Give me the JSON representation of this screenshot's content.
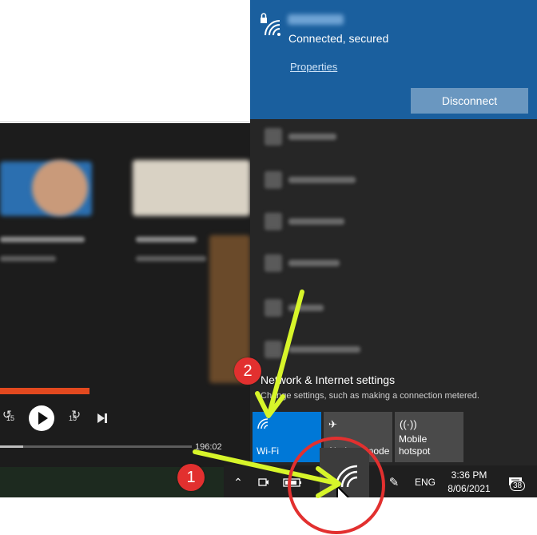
{
  "player": {
    "rewind_label": "15",
    "forward_label": "15",
    "time": "196:02",
    "progress_fraction": 0.12
  },
  "flyout": {
    "connected_network": {
      "status": "Connected, secured",
      "properties_link": "Properties",
      "disconnect_label": "Disconnect"
    },
    "settings": {
      "title": "Network & Internet settings",
      "subtitle": "Change settings, such as making a connection metered."
    },
    "quick_actions": [
      {
        "label": "Wi-Fi",
        "icon": "wifi-icon",
        "active": true
      },
      {
        "label": "Airplane mode",
        "icon": "airplane-icon",
        "active": false
      },
      {
        "label": "Mobile hotspot",
        "icon": "hotspot-icon",
        "active": false
      }
    ]
  },
  "taskbar": {
    "language": "ENG",
    "time": "3:36 PM",
    "date": "8/06/2021",
    "notification_count": "38"
  },
  "annotations": {
    "badge_1": "1",
    "badge_2": "2"
  },
  "colors": {
    "accent_blue": "#1a5f9e",
    "wifi_tile": "#0078d7",
    "annotation_red": "#e2302f",
    "arrow_yellow": "#d7f52a"
  }
}
